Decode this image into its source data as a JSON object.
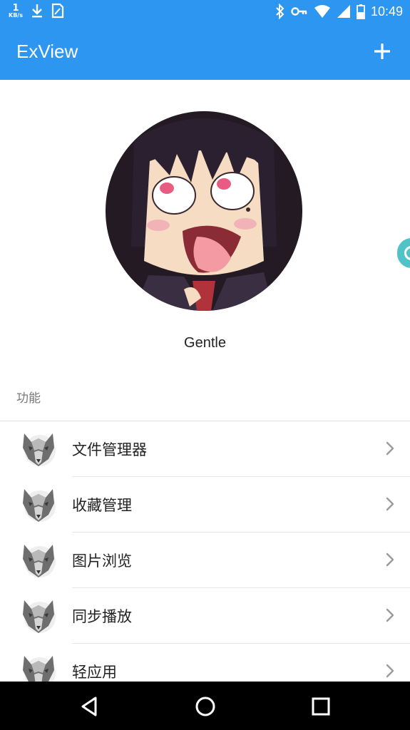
{
  "status_bar": {
    "net_speed_value": "1",
    "net_speed_unit": "KB/s",
    "time": "10:49",
    "icons": [
      "download-icon",
      "sim-card-icon",
      "bluetooth-icon",
      "key-icon",
      "wifi-icon",
      "signal-icon",
      "battery-icon"
    ]
  },
  "app_bar": {
    "title": "ExView",
    "add_icon": "plus-icon"
  },
  "profile": {
    "username": "Gentle"
  },
  "section": {
    "label": "功能"
  },
  "menu": {
    "items": [
      {
        "label": "文件管理器"
      },
      {
        "label": "收藏管理"
      },
      {
        "label": "图片浏览"
      },
      {
        "label": "同步播放"
      },
      {
        "label": "轻应用"
      }
    ]
  },
  "nav_bar": {
    "buttons": [
      "back-icon",
      "home-icon",
      "recents-icon"
    ]
  },
  "colors": {
    "primary": "#2d96f0",
    "floating_button": "#4fc3c7",
    "nav_bar": "#000000"
  }
}
